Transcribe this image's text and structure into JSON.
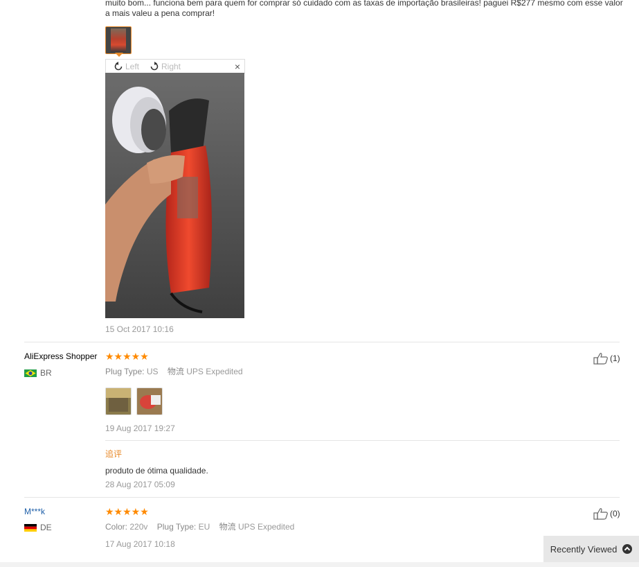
{
  "review_top": {
    "text": "muito bom... funciona bem para quem for comprar só cuidado com as taxas de importação brasileiras! paguei R$277 mesmo com esse valor a mais valeu a pena comprar!",
    "viewer": {
      "rotate_left": "Left",
      "rotate_right": "Right",
      "close": "×"
    },
    "date": "15 Oct 2017 10:16"
  },
  "review_2": {
    "name": "AliExpress Shopper",
    "country": "BR",
    "stars": "★★★★★",
    "plug_label": "Plug Type:",
    "plug_value": "US",
    "ship_label": "物流",
    "ship_value": "UPS Expedited",
    "date": "19 Aug 2017 19:27",
    "likes": "(1)",
    "followup_label": "追评",
    "followup_text": "produto de ótima qualidade.",
    "followup_date": "28 Aug 2017 05:09"
  },
  "review_3": {
    "name": "M***k",
    "country": "DE",
    "stars": "★★★★★",
    "color_label": "Color:",
    "color_value": "220v",
    "plug_label": "Plug Type:",
    "plug_value": "EU",
    "ship_label": "物流",
    "ship_value": "UPS Expedited",
    "date": "17 Aug 2017 10:18",
    "likes": "(0)"
  },
  "recently_viewed": {
    "label": "Recently Viewed",
    "icon": "chevron-up-icon"
  },
  "colors": {
    "accent": "#e88a2a",
    "star": "#ff8a00",
    "link": "#1e5fa8"
  }
}
